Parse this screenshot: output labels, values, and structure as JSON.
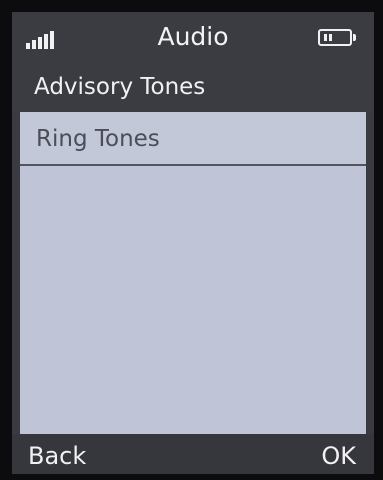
{
  "header": {
    "title": "Audio",
    "signal_icon": "signal-bars-icon",
    "battery_icon": "battery-icon"
  },
  "menu": {
    "items": [
      {
        "label": "Advisory Tones"
      },
      {
        "label": "Ring Tones",
        "selected": true
      }
    ]
  },
  "softkeys": {
    "left": "Back",
    "right": "OK"
  },
  "colors": {
    "bar_background": "#3b3c41",
    "content_background": "#bfc5d6",
    "text_light": "#f1f1f3",
    "text_dark": "#4b4e57"
  }
}
